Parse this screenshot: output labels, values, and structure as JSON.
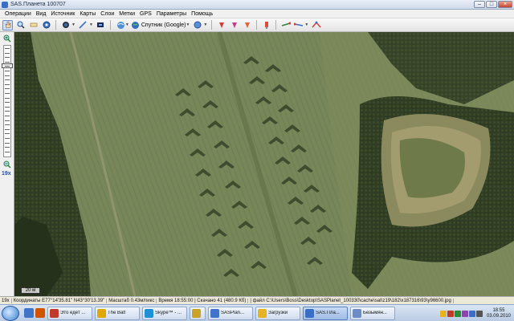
{
  "window": {
    "title": "SAS.Планета 100707"
  },
  "menu": [
    "Операции",
    "Вид",
    "Источник",
    "Карты",
    "Слои",
    "Метки",
    "GPS",
    "Параметры",
    "Помощь"
  ],
  "toolbar": {
    "map_source": "Спутник (Google)"
  },
  "zoom": {
    "label": "19x",
    "level_fraction": 0.17
  },
  "map": {
    "scale_label": "20 м"
  },
  "status": {
    "zoom": "19x",
    "coords": "Координаты E77°14'35.81\" N43°30'13.39\"",
    "scale": "Масштаб 0.43м/пикс",
    "time": "Время 18:55:00 | Скачано 41 (480.9 Кб)",
    "file": "| файл C:\\Users\\Boss\\Desktop\\SASPlanet_100330\\cache\\sat\\z19\\182\\x187316\\93\\y96600.jpg"
  },
  "taskbar": {
    "tasks": [
      {
        "label": "Это едет ...",
        "color": "#c0392b"
      },
      {
        "label": "The Bat!",
        "color": "#e0a800"
      },
      {
        "label": "Skype™ - ...",
        "color": "#1f8fd6"
      },
      {
        "label": "",
        "color": "#c9a227"
      },
      {
        "label": "SASPlan...",
        "color": "#3f74c9"
      },
      {
        "label": "Загрузки",
        "color": "#e6b422"
      },
      {
        "label": "SAS.Пла...",
        "color": "#3a6ec6"
      },
      {
        "label": "Безымян...",
        "color": "#6b8cc6"
      }
    ],
    "clock_time": "18:55",
    "clock_date": "03.09.2010"
  }
}
